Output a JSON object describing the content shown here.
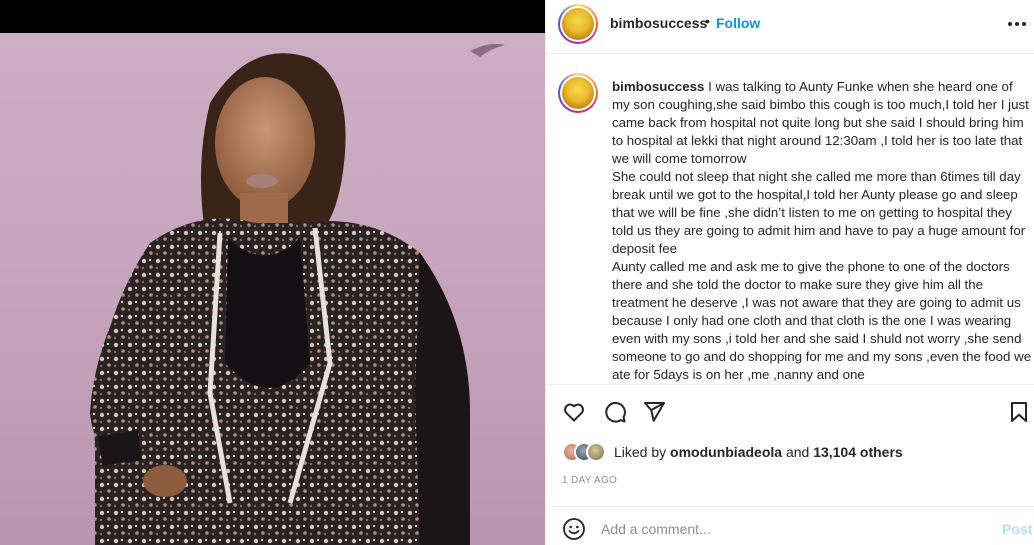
{
  "post": {
    "username": "bimbosuccess",
    "follow_label": "Follow",
    "separator": "•"
  },
  "caption": {
    "username": "bimbosuccess",
    "paragraphs": [
      "I was talking to Aunty Funke when she heard one of my son coughing,she said bimbo this cough is too much,I told her I just came back from hospital not quite long but she said I should bring him to hospital at lekki that night around 12:30am ,I told her is too late that we will come tomorrow",
      "She could not sleep that night she called me more than 6times till day break until we got to the hospital,I told her Aunty please go and sleep that we will be fine ,she didn’t listen to me on getting to hospital they told us they are going to admit him and have to pay a huge amount for deposit fee",
      "Aunty called me and ask me to give the phone to one of the doctors there and she told the doctor to make sure they give him all the treatment he deserve ,I was not aware that they are going to admit us because I only had one cloth and that cloth is the one I was wearing even with my sons ,i told her and she said I shuld not worry ,she send someone to go and do shopping for me and my sons ,even the food we ate for 5days is on her ,me ,nanny and one"
    ]
  },
  "likes": {
    "prefix": "Liked by",
    "first_user": "omodunbiadeola",
    "conjunction": "and",
    "others": "13,104 others"
  },
  "timestamp": "1 DAY AGO",
  "comment_box": {
    "placeholder": "Add a comment...",
    "post_label": "Post"
  },
  "icons": {
    "like": "heart-icon",
    "comment": "comment-icon",
    "share": "paper-plane-icon",
    "save": "bookmark-icon",
    "more": "more-options-icon",
    "emoji": "emoji-icon"
  },
  "colors": {
    "accent": "#0095f6",
    "post_disabled": "#b2dffc",
    "muted": "#8e8e8e",
    "text": "#262626"
  }
}
